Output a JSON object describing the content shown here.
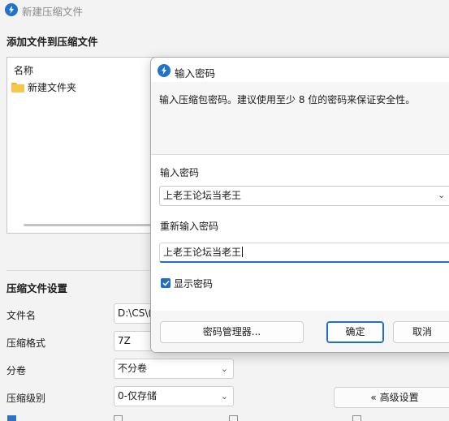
{
  "main_window": {
    "title": "新建压缩文件",
    "add_section_title": "添加文件到压缩文件",
    "file_list": {
      "column_name": "名称",
      "items": [
        {
          "name": "新建文件夹",
          "icon": "folder-icon"
        }
      ]
    },
    "settings_section_title": "压缩文件设置",
    "fields": {
      "filename_label": "文件名",
      "filename_value": "D:\\CS\\(",
      "format_label": "压缩格式",
      "format_value": "7Z",
      "split_label": "分卷",
      "split_value": "不分卷",
      "level_label": "压缩级别",
      "level_value": "0-仅存储"
    },
    "advanced_button": "« 高级设置"
  },
  "password_dialog": {
    "title": "输入密码",
    "message": "输入压缩包密码。建议使用至少 8 位的密码来保证安全性。",
    "password_label": "输入密码",
    "password_value": "上老王论坛当老王",
    "reenter_label": "重新输入密码",
    "reenter_value": "上老王论坛当老王",
    "show_password_label": "显示密码",
    "show_password_checked": true,
    "buttons": {
      "password_manager": "密码管理器...",
      "ok": "确定",
      "cancel": "取消"
    }
  },
  "colors": {
    "accent": "#1f6fc9",
    "app_icon": "#2173c9",
    "background": "#f3f3f3"
  }
}
